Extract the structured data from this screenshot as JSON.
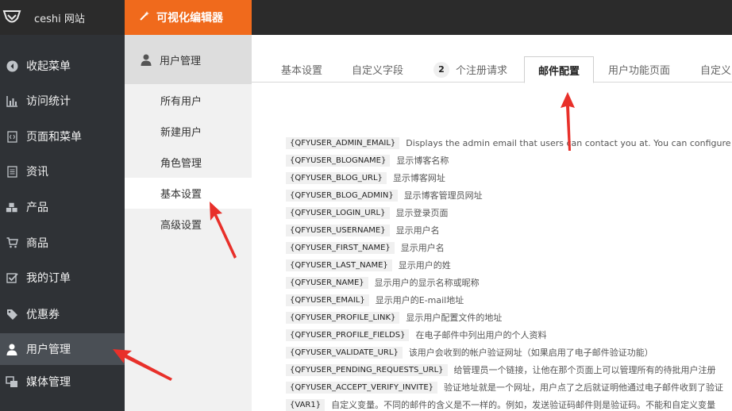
{
  "topbar": {
    "site_name": "ceshi 网站",
    "visual_editor": "可视化编辑器"
  },
  "sidebar": {
    "items": [
      {
        "label": "收起菜单",
        "icon": "collapse-arrow-icon"
      },
      {
        "label": "访问统计",
        "icon": "bar-chart-icon"
      },
      {
        "label": "页面和菜单",
        "icon": "page-code-icon"
      },
      {
        "label": "资讯",
        "icon": "document-icon"
      },
      {
        "label": "产品",
        "icon": "cubes-icon"
      },
      {
        "label": "商品",
        "icon": "cart-icon"
      },
      {
        "label": "我的订单",
        "icon": "checkbox-icon"
      },
      {
        "label": "优惠券",
        "icon": "tag-icon"
      },
      {
        "label": "用户管理",
        "icon": "user-icon"
      },
      {
        "label": "媒体管理",
        "icon": "media-icon"
      }
    ],
    "active_index": 8
  },
  "submenu": {
    "title": "用户管理",
    "items": [
      "所有用户",
      "新建用户",
      "角色管理",
      "基本设置",
      "高级设置"
    ],
    "active_index": 3
  },
  "tabs": {
    "items": [
      "基本设置",
      "自定义字段",
      "个注册请求",
      "邮件配置",
      "用户功能页面",
      "自定义"
    ],
    "pending_count": "2",
    "active_index": 3
  },
  "variables": [
    {
      "code": "{QFYUSER_ADMIN_EMAIL}",
      "desc": "Displays the admin email that users can contact you at. You can configure it"
    },
    {
      "code": "{QFYUSER_BLOGNAME}",
      "desc": "显示博客名称"
    },
    {
      "code": "{QFYUSER_BLOG_URL}",
      "desc": "显示博客网址"
    },
    {
      "code": "{QFYUSER_BLOG_ADMIN}",
      "desc": "显示博客管理员网址"
    },
    {
      "code": "{QFYUSER_LOGIN_URL}",
      "desc": "显示登录页面"
    },
    {
      "code": "{QFYUSER_USERNAME}",
      "desc": "显示用户名"
    },
    {
      "code": "{QFYUSER_FIRST_NAME}",
      "desc": "显示用户名"
    },
    {
      "code": "{QFYUSER_LAST_NAME}",
      "desc": "显示用户的姓"
    },
    {
      "code": "{QFYUSER_NAME}",
      "desc": "显示用户的显示名称或昵称"
    },
    {
      "code": "{QFYUSER_EMAIL}",
      "desc": "显示用户的E-mail地址"
    },
    {
      "code": "{QFYUSER_PROFILE_LINK}",
      "desc": "显示用户配置文件的地址"
    },
    {
      "code": "{QFYUSER_PROFILE_FIELDS}",
      "desc": "在电子邮件中列出用户的个人资料"
    },
    {
      "code": "{QFYUSER_VALIDATE_URL}",
      "desc": "该用户会收到的帐户验证网址（如果启用了电子邮件验证功能）"
    },
    {
      "code": "{QFYUSER_PENDING_REQUESTS_URL}",
      "desc": "给管理员一个链接，让他在那个页面上可以管理所有的待批用户注册"
    },
    {
      "code": "{QFYUSER_ACCEPT_VERIFY_INVITE}",
      "desc": "验证地址就是一个网址，用户点了之后就证明他通过电子邮件收到了验证"
    },
    {
      "code": "{VAR1}",
      "desc": "自定义变量。不同的邮件的含义是不一样的。例如，发送验证码邮件则是验证码。不能和自定义变量"
    }
  ],
  "colors": {
    "topbar": "#2b2b2b",
    "accent": "#f06a1c",
    "sidebar": "#2f3236",
    "annotation": "#e8302a"
  }
}
